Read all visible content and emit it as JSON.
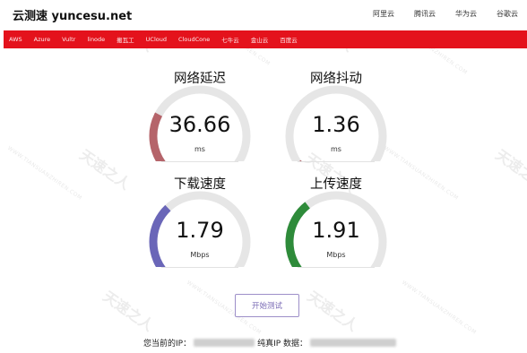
{
  "header": {
    "brand": "云测速 yuncesu.net",
    "links": [
      "阿里云",
      "腾讯云",
      "华为云",
      "谷歌云"
    ]
  },
  "navbar": {
    "items": [
      "AWS",
      "Azure",
      "Vultr",
      "linode",
      "搬瓦工",
      "UCloud",
      "CloudCone",
      "七牛云",
      "金山云",
      "百度云"
    ]
  },
  "gauges": [
    {
      "title": "网络延迟",
      "value": "36.66",
      "unit": "ms",
      "fraction": 0.27,
      "color": "#b5646a"
    },
    {
      "title": "网络抖动",
      "value": "1.36",
      "unit": "ms",
      "fraction": 0.04,
      "color": "#b5646a"
    },
    {
      "title": "下载速度",
      "value": "1.79",
      "unit": "Mbps",
      "fraction": 0.34,
      "color": "#6a66b8"
    },
    {
      "title": "上传速度",
      "value": "1.91",
      "unit": "Mbps",
      "fraction": 0.36,
      "color": "#2e8b3a"
    }
  ],
  "start_button": {
    "label": "开始测试"
  },
  "ip_info": {
    "label_ip": "您当前的IP：",
    "label_pure": "纯真IP 数据："
  },
  "watermark": {
    "brand": "天速之人",
    "url": "WWW.TIANSUANZHIREN.COM"
  }
}
